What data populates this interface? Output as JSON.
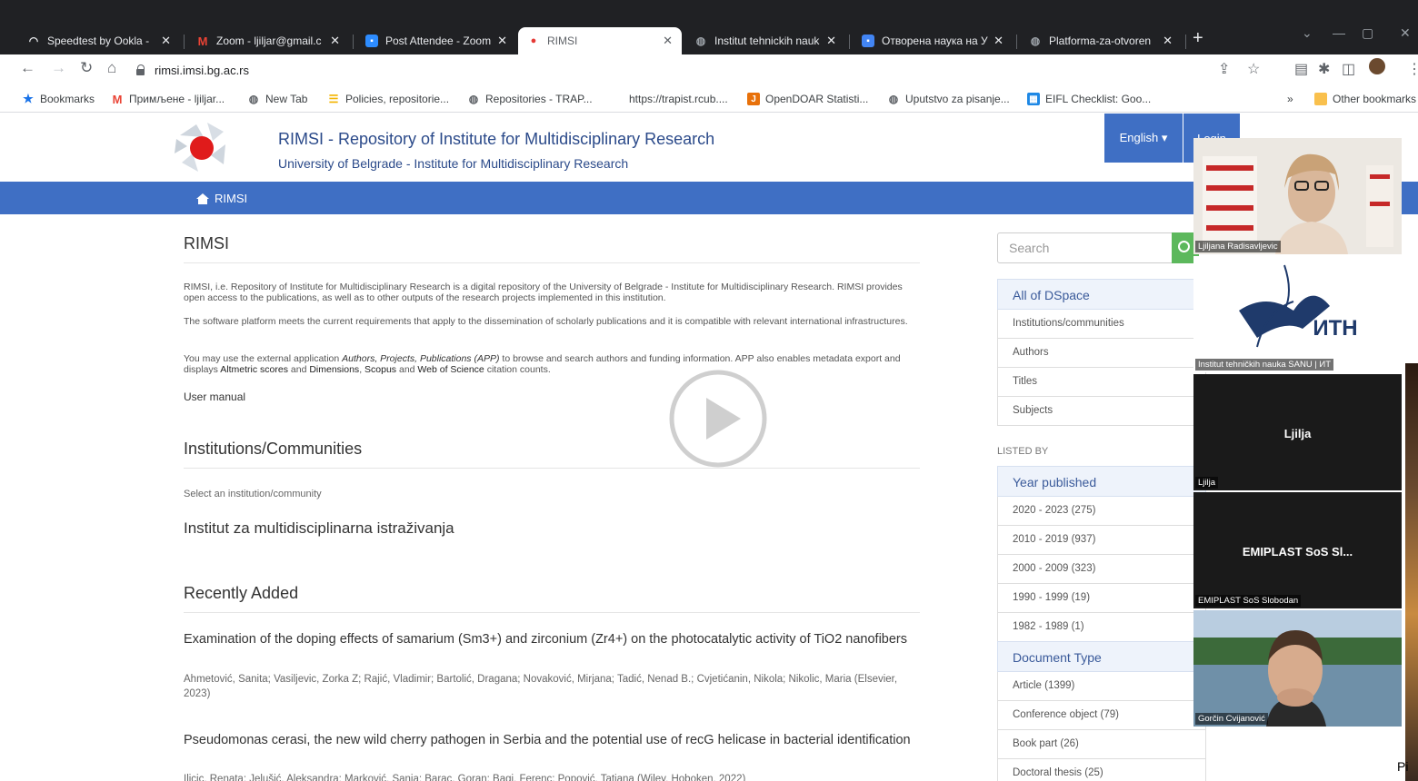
{
  "browser": {
    "tabs": [
      {
        "label": "Speedtest by Ookla -",
        "icon": "speedtest-icon",
        "color": "#e8eaed"
      },
      {
        "label": "Zoom - ljiljar@gmail.c",
        "icon": "gmail-icon",
        "color": "#ea4335"
      },
      {
        "label": "Post Attendee - Zoom",
        "icon": "zoom-icon",
        "color": "#2d8cff"
      },
      {
        "label": "RIMSI",
        "icon": "rimsi-icon",
        "color": "#e53935"
      },
      {
        "label": "Institut tehnickih nauk",
        "icon": "globe-icon",
        "color": "#9aa0a6"
      },
      {
        "label": "Отворена наука на У",
        "icon": "bookmark-flag-icon",
        "color": "#4285f4"
      },
      {
        "label": "Platforma-za-otvoren",
        "icon": "globe-icon",
        "color": "#9aa0a6"
      }
    ],
    "new_tab": "+",
    "url": "rimsi.imsi.bg.ac.rs",
    "bookmarks": [
      {
        "label": "Bookmarks",
        "icon": "star-icon"
      },
      {
        "label": "Примљене - ljiljar...",
        "icon": "gmail-icon"
      },
      {
        "label": "New Tab",
        "icon": "globe-icon"
      },
      {
        "label": "Policies, repositorie...",
        "icon": "policies-icon"
      },
      {
        "label": "Repositories - TRAP...",
        "icon": "globe-icon"
      },
      {
        "label": "https://trapist.rcub....",
        "icon": ""
      },
      {
        "label": "OpenDOAR Statisti...",
        "icon": "opendoar-icon"
      },
      {
        "label": "Uputstvo za pisanje...",
        "icon": "globe-icon"
      },
      {
        "label": "EIFL Checklist: Goo...",
        "icon": "sheets-icon"
      }
    ],
    "bookmarks_overflow": "»",
    "other_bookmarks": "Other bookmarks"
  },
  "site": {
    "title": "RIMSI - Repository of Institute for Multidisciplinary Research",
    "subtitle": "University of Belgrade - Institute for Multidisciplinary Research",
    "lang": "English ▾",
    "login": "Login",
    "breadcrumb": "RIMSI"
  },
  "main": {
    "heading": "RIMSI",
    "intro_p1": "RIMSI, i.e. Repository of Institute for Multidisciplinary Research is a digital repository of the University of Belgrade - Institute for Multidisciplinary Research. RIMSI provides open access to the publications, as well as to other outputs of the research projects implemented in this institution.",
    "intro_p2": "The software platform meets the current requirements that apply to the dissemination of scholarly publications and it is compatible with relevant international infrastructures.",
    "intro_p3_a": "You may use the external application ",
    "intro_p3_app": "Authors, Projects, Publications (APP)",
    "intro_p3_b": " to browse and search authors and funding information. APP also enables metadata export and displays ",
    "intro_p3_altmetric": "Altmetric scores",
    "intro_p3_and": " and ",
    "intro_p3_dimensions": "Dimensions",
    "intro_p3_comma": ", ",
    "intro_p3_scopus": "Scopus",
    "intro_p3_and2": " and ",
    "intro_p3_wos": "Web of Science",
    "intro_p3_c": " citation counts.",
    "user_manual": "User manual",
    "communities_heading": "Institutions/Communities",
    "communities_hint": "Select an institution/community",
    "community": "Institut za multidisciplinarna istraživanja",
    "recent_heading": "Recently Added",
    "items": [
      {
        "title": "Examination of the doping effects of samarium (Sm3+) and zirconium (Zr4+) on the photocatalytic activity of TiO2 nanofibers",
        "authors": "Ahmetović, Sanita; Vasiljevic, Zorka Z; Rajić, Vladimir; Bartolić, Dragana; Novaković, Mirjana; Tadić, Nenad B.; Cvjetićanin, Nikola; Nikolic, Maria (Elsevier, 2023)"
      },
      {
        "title": "Pseudomonas cerasi, the new wild cherry pathogen in Serbia and the potential use of recG helicase in bacterial identification",
        "authors": "Ilicic, Renata; Jelušić, Aleksandra; Marković, Sanja; Barac, Goran; Bagi, Ferenc; Popović, Tatjana (Wiley, Hoboken, 2022)"
      }
    ]
  },
  "sidebar": {
    "search_placeholder": "Search",
    "browse_head": "All of DSpace",
    "browse": [
      "Institutions/communities",
      "Authors",
      "Titles",
      "Subjects"
    ],
    "listed_by": "LISTED BY",
    "year_head": "Year published",
    "years": [
      "2020 - 2023 (275)",
      "2010 - 2019 (937)",
      "2000 - 2009 (323)",
      "1990 - 1999 (19)",
      "1982 - 1989 (1)"
    ],
    "doctype_head": "Document Type",
    "doctypes": [
      "Article (1399)",
      "Conference object (79)",
      "Book part (26)",
      "Doctoral thesis (25)"
    ]
  },
  "zoom": {
    "participants": [
      {
        "caption": "Ljiljana Radisavljevic",
        "center": "",
        "kind": "camera-office"
      },
      {
        "caption": "Institut tehničkih nauka SANU | ИТ",
        "center": "",
        "kind": "logo"
      },
      {
        "caption": "Ljilja",
        "center": "Ljilja",
        "kind": "name"
      },
      {
        "caption": "EMIPLAST SoS Slobodan",
        "center": "EMIPLAST SoS Sl...",
        "kind": "name"
      },
      {
        "caption": "Gorčin Cvijanović",
        "center": "",
        "kind": "camera-lake"
      }
    ],
    "logo_text": "ИТН"
  },
  "corner_text": "Pi"
}
